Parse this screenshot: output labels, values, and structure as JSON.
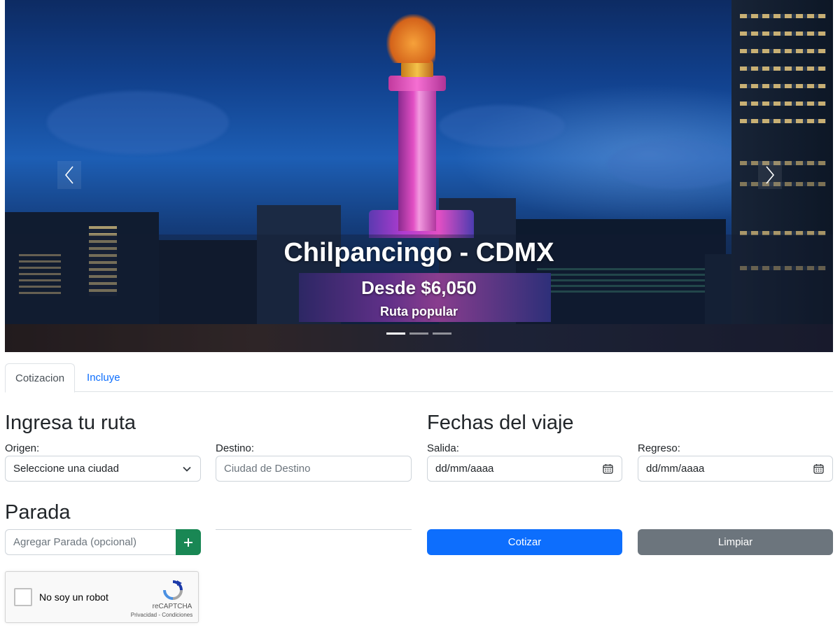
{
  "carousel": {
    "slide_title": "Chilpancingo - CDMX",
    "slide_price": "Desde $6,050",
    "slide_tag": "Ruta popular",
    "indicator_count": 3,
    "active_index": 0
  },
  "tabs": [
    {
      "label": "Cotizacion",
      "active": true
    },
    {
      "label": "Incluye",
      "active": false
    }
  ],
  "route": {
    "heading": "Ingresa tu ruta",
    "origin_label": "Origen:",
    "origin_value": "Seleccione una ciudad",
    "destination_label": "Destino:",
    "destination_placeholder": "Ciudad de Destino"
  },
  "dates": {
    "heading": "Fechas del viaje",
    "departure_label": "Salida:",
    "departure_value": "dd/mm/aaaa",
    "return_label": "Regreso:",
    "return_value": "dd/mm/aaaa"
  },
  "stop": {
    "heading": "Parada",
    "placeholder": "Agregar Parada (opcional)"
  },
  "actions": {
    "quote_label": "Cotizar",
    "clear_label": "Limpiar"
  },
  "recaptcha": {
    "label": "No soy un robot",
    "brand": "reCAPTCHA",
    "terms": "Privacidad - Condiciones"
  },
  "colors": {
    "primary": "#0d6efd",
    "secondary": "#6c757d",
    "success": "#198754",
    "tab_link": "#0d6efd"
  },
  "icons": [
    "chevron-left-icon",
    "chevron-right-icon",
    "chevron-down-icon",
    "calendar-icon",
    "plus-icon",
    "recaptcha-logo-icon"
  ]
}
